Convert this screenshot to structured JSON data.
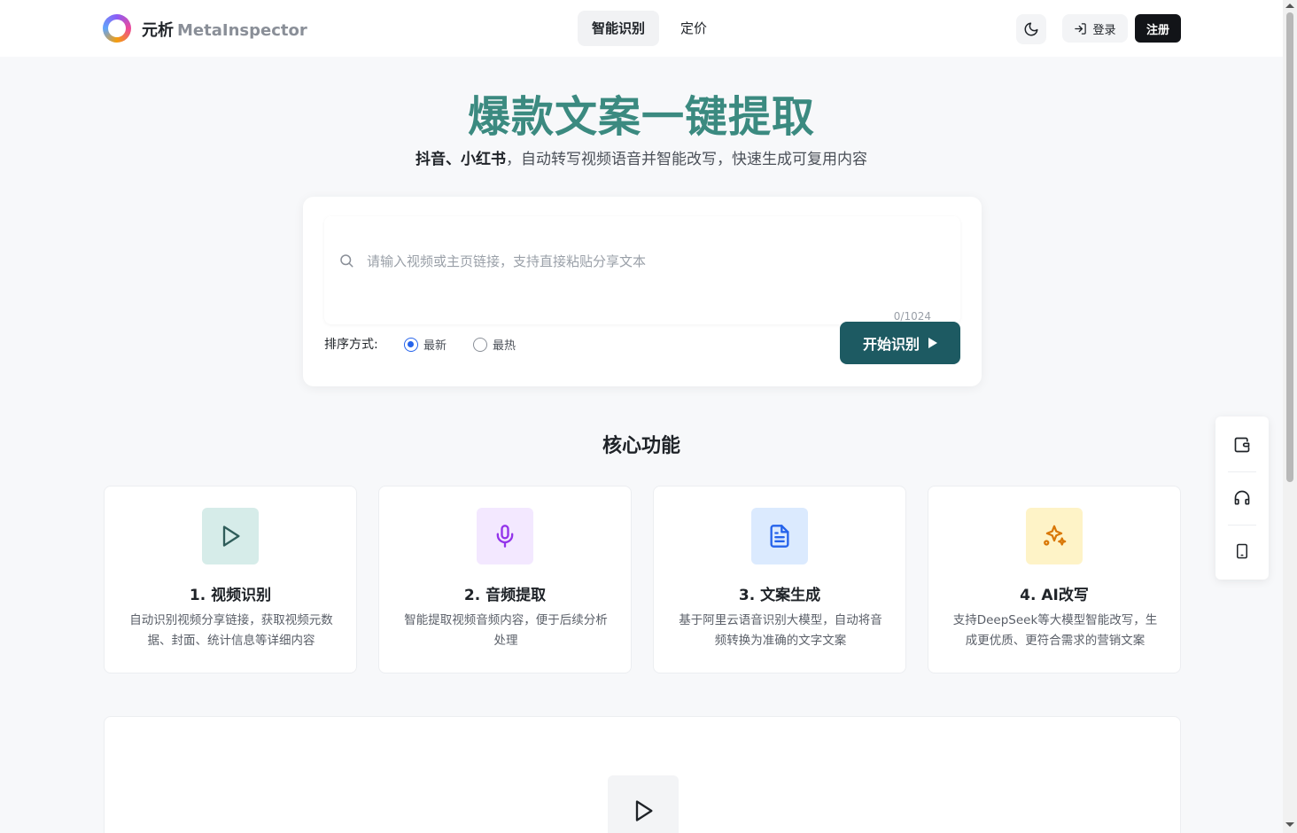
{
  "header": {
    "brand_cn": "元析",
    "brand_en": "MetaInspector",
    "nav": [
      {
        "label": "智能识别"
      },
      {
        "label": "定价"
      }
    ],
    "login_label": "登录",
    "signup_label": "注册"
  },
  "hero": {
    "title": "爆款文案一键提取",
    "sub_bold": "抖音、小红书",
    "sub_rest": "，自动转写视频语音并智能改写，快速生成可复用内容"
  },
  "input": {
    "placeholder": "请输入视频或主页链接，支持直接粘贴分享文本",
    "counter": "0/1024",
    "sort_label": "排序方式:",
    "sort_options": [
      {
        "label": "最新",
        "checked": true
      },
      {
        "label": "最热",
        "checked": false
      }
    ],
    "submit_label": "开始识别"
  },
  "features": {
    "section_title": "核心功能",
    "items": [
      {
        "title": "1. 视频识别",
        "desc": "自动识别视频分享链接，获取视频元数据、封面、统计信息等详细内容",
        "icon": "play-icon",
        "color": "#2f5d5a",
        "bg": "#d6ece9"
      },
      {
        "title": "2. 音频提取",
        "desc": "智能提取视频音频内容，便于后续分析处理",
        "icon": "microphone-icon",
        "color": "#9333ea",
        "bg": "#f3e8ff"
      },
      {
        "title": "3. 文案生成",
        "desc": "基于阿里云语音识别大模型，自动将音频转换为准确的文字文案",
        "icon": "document-icon",
        "color": "#2563eb",
        "bg": "#dbeafe"
      },
      {
        "title": "4. AI改写",
        "desc": "支持DeepSeek等大模型智能改写，生成更优质、更符合需求的营销文案",
        "icon": "sparkles-icon",
        "color": "#d97706",
        "bg": "#fef3c7"
      }
    ]
  },
  "side_float": {
    "items": [
      {
        "icon": "wallet-icon"
      },
      {
        "icon": "headset-icon"
      },
      {
        "icon": "tablet-icon"
      }
    ]
  }
}
